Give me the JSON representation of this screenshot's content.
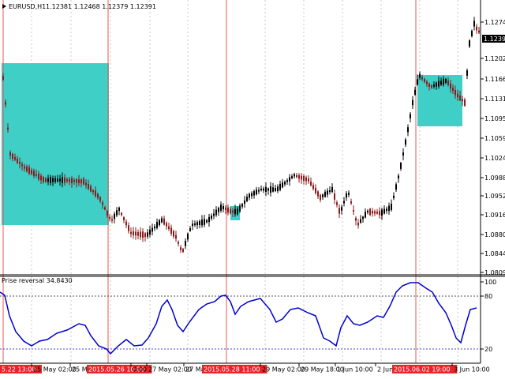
{
  "chart_header": {
    "symbol": "EURUSD,H1",
    "ohlc": "1.12381 1.12468 1.12379 1.12391"
  },
  "indicator": {
    "label": "Prise reversal 34.8430",
    "levels": {
      "upper": 80,
      "lower": 20
    },
    "scale_labels": [
      "100",
      "80",
      "20",
      "0"
    ],
    "color": "#0000cc"
  },
  "colors": {
    "background": "#ffffff",
    "bull_candle": "#000000",
    "bear_candle": "#8b1a1a",
    "zone_fill": "#3fcfc7",
    "marker_line": "#e8584f",
    "marker_label_bg": "#e8242a",
    "current_price_bg": "#000000"
  },
  "price_axis": {
    "labels": [
      "1.12746",
      "1.12391",
      "1.12020",
      "1.11660",
      "1.11310",
      "1.10950",
      "1.10590",
      "1.10240",
      "1.09880",
      "1.09520",
      "1.09160",
      "1.08800",
      "1.08440",
      "1.08090"
    ],
    "current_price": "1.12391"
  },
  "time_axis": {
    "labels": [
      {
        "text": "5.22 13:00",
        "highlighted": true
      },
      {
        "text": "25 May 02:00",
        "highlighted": false
      },
      {
        "text": "25 Ma",
        "highlighted": false
      },
      {
        "text": "2015.05.26 10:00",
        "highlighted": true
      },
      {
        "text": "0:00",
        "highlighted": false
      },
      {
        "text": "27 May 02:00",
        "highlighted": false
      },
      {
        "text": "27 May 18:00",
        "highlighted": false
      },
      {
        "text": "2015.05.28 11:00",
        "highlighted": true
      },
      {
        "text": "29 May 02:00",
        "highlighted": false
      },
      {
        "text": "29 May 18:00",
        "highlighted": false
      },
      {
        "text": "1 Jun 10:00",
        "highlighted": false
      },
      {
        "text": "2 Jun",
        "highlighted": false
      },
      {
        "text": "2015.06.02 19:00",
        "highlighted": true
      },
      {
        "text": "3 Jun 10:00",
        "highlighted": false
      }
    ]
  }
}
